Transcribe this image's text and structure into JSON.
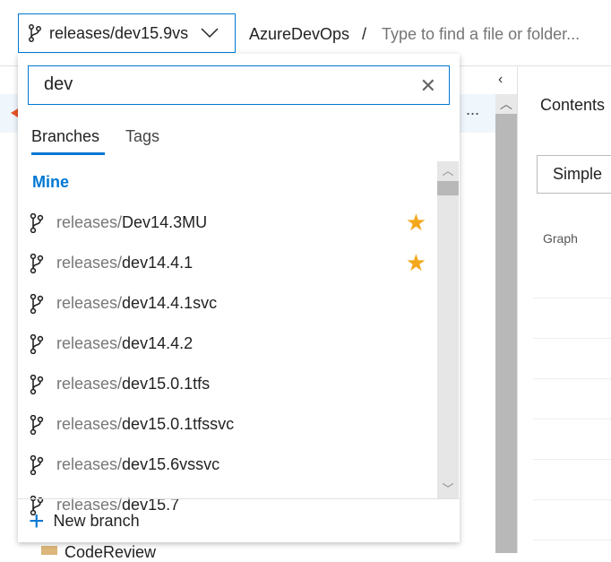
{
  "header": {
    "branch": "releases/dev15.9vs",
    "repo": "AzureDevOps",
    "separator": "/",
    "path_placeholder": "Type to find a file or folder..."
  },
  "background": {
    "more": "...",
    "collapse": "‹",
    "contents": "Contents",
    "view_select": "Simple",
    "graph": "Graph",
    "folder": "CodeReview"
  },
  "dropdown": {
    "search_value": "dev",
    "tabs": [
      {
        "label": "Branches",
        "active": true
      },
      {
        "label": "Tags",
        "active": false
      }
    ],
    "section": "Mine",
    "items": [
      {
        "prefix": "releases/",
        "name": "Dev14.3MU",
        "favorite": true
      },
      {
        "prefix": "releases/",
        "name": "dev14.4.1",
        "favorite": true
      },
      {
        "prefix": "releases/",
        "name": "dev14.4.1svc",
        "favorite": false
      },
      {
        "prefix": "releases/",
        "name": "dev14.4.2",
        "favorite": false
      },
      {
        "prefix": "releases/",
        "name": "dev15.0.1tfs",
        "favorite": false
      },
      {
        "prefix": "releases/",
        "name": "dev15.0.1tfssvc",
        "favorite": false
      },
      {
        "prefix": "releases/",
        "name": "dev15.6vssvc",
        "favorite": false
      },
      {
        "prefix": "releases/",
        "name": "dev15.7",
        "favorite": false
      }
    ],
    "new_branch": "New branch"
  },
  "colors": {
    "accent": "#0078d4",
    "star": "#f2a81d"
  }
}
